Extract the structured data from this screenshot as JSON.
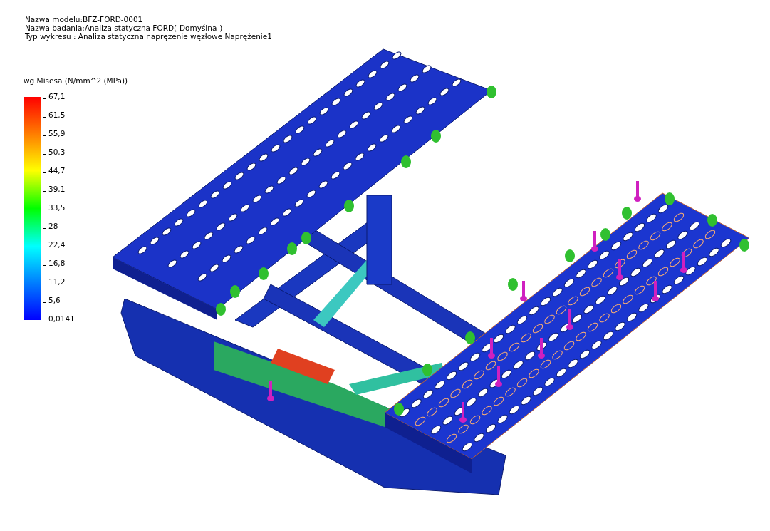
{
  "header_lines": [
    "Nazwa modelu:BFZ-FORD-0001",
    "Nazwa badania:Analiza statyczna FORD(-Domyślna-)",
    "Typ wykresu : Analiza statyczna naprężenie węzłowe Naprężenie1"
  ],
  "legend": {
    "title": "wg Misesa (N/mm^2 (MPa))",
    "labels": [
      "67,1",
      "61,5",
      "55,9",
      "50,3",
      "44,7",
      "39,1",
      "33,5",
      "28",
      "22,4",
      "16,8",
      "11,2",
      "5,6",
      "0,0141"
    ]
  }
}
